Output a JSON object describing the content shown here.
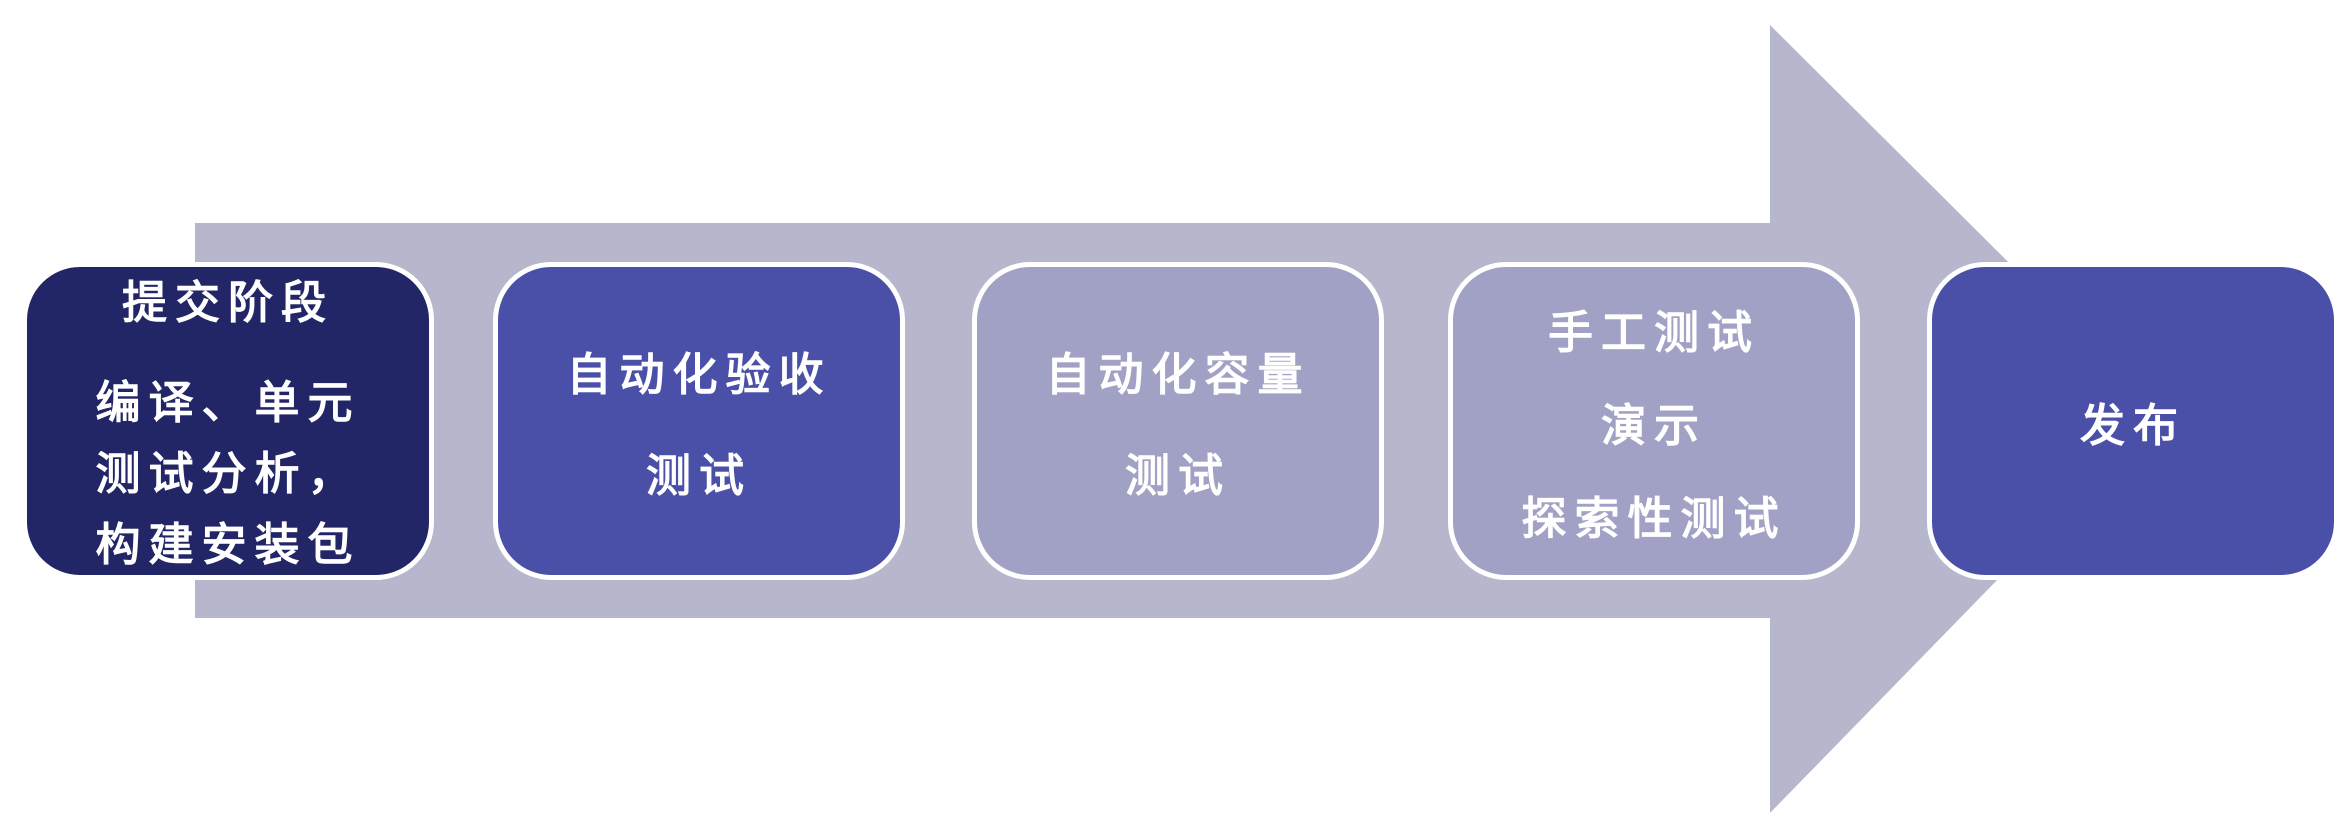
{
  "stages": [
    {
      "title": "提交阶段",
      "lines": [
        "编译、单元",
        "测试分析，",
        "构建安装包"
      ]
    },
    {
      "lines": [
        "自动化验收",
        "测试"
      ]
    },
    {
      "lines": [
        "自动化容量",
        "测试"
      ]
    },
    {
      "lines": [
        "手工测试",
        "演示",
        "探索性测试"
      ]
    },
    {
      "lines": [
        "发布"
      ]
    }
  ],
  "colors": {
    "arrow": "#b6b6cd",
    "stage_dark": "#222566",
    "stage_medium": "#4a50a8",
    "stage_light": "#a1a1c5",
    "border": "#ffffff",
    "text": "#ffffff"
  }
}
